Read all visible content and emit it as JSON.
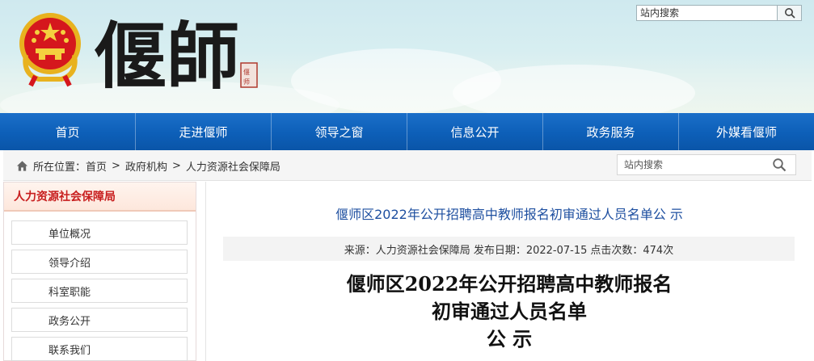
{
  "header": {
    "site_calligraphy": "偃師",
    "seal_text": "偃师",
    "top_search": {
      "placeholder": "站内搜索"
    }
  },
  "nav": {
    "items": [
      {
        "label": "首页"
      },
      {
        "label": "走进偃师"
      },
      {
        "label": "领导之窗"
      },
      {
        "label": "信息公开"
      },
      {
        "label": "政务服务"
      },
      {
        "label": "外媒看偃师"
      }
    ]
  },
  "breadcrumb": {
    "prefix": "所在位置：",
    "items": [
      "首页",
      "政府机构",
      "人力资源社会保障局"
    ],
    "separator": ">"
  },
  "sub_search": {
    "placeholder": "站内搜索"
  },
  "sidebar": {
    "title": "人力资源社会保障局",
    "items": [
      {
        "label": "单位概况"
      },
      {
        "label": "领导介绍"
      },
      {
        "label": "科室职能"
      },
      {
        "label": "政务公开"
      },
      {
        "label": "联系我们"
      }
    ]
  },
  "article": {
    "link_title": "偃师区2022年公开招聘高中教师报名初审通过人员名单公 示",
    "meta": {
      "source": "来源：人力资源社会保障局",
      "date": "发布日期：2022-07-15",
      "clicks": "点击次数：474次"
    },
    "title_lines": [
      "偃师区2022年公开招聘高中教师报名",
      "初审通过人员名单",
      "公 示"
    ]
  },
  "colors": {
    "nav_blue": "#0d5fb8",
    "sidebar_title_red": "#c81e1e",
    "article_link_blue": "#1e4fa0"
  },
  "icons": [
    "national-emblem-icon",
    "search-icon",
    "home-icon"
  ]
}
